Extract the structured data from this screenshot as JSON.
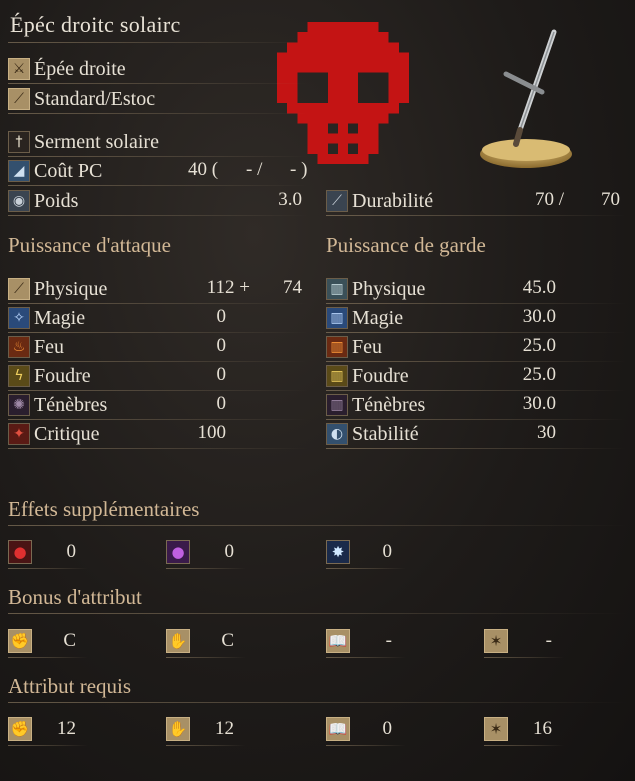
{
  "item_name": "Épéc droitc solairc",
  "weapon": {
    "type": "Épée droite",
    "attack_type": "Standard/Estoc",
    "skill": "Serment solaire",
    "fp_cost_label": "Coût PC",
    "fp_cost_value": "40 (",
    "fp_cost_mid": "- /",
    "fp_cost_end": "- )",
    "weight_label": "Poids",
    "weight_value": "3.0",
    "durability_label": "Durabilité",
    "durability_current": "70 /",
    "durability_max": "70"
  },
  "attack": {
    "header": "Puissance d'attaque",
    "rows": [
      {
        "label": "Physique",
        "value": "112 +",
        "extra": "74",
        "icon": "physical-attack-icon"
      },
      {
        "label": "Magie",
        "value": "0",
        "extra": "",
        "icon": "magic-icon"
      },
      {
        "label": "Feu",
        "value": "0",
        "extra": "",
        "icon": "fire-icon"
      },
      {
        "label": "Foudre",
        "value": "0",
        "extra": "",
        "icon": "lightning-icon"
      },
      {
        "label": "Ténèbres",
        "value": "0",
        "extra": "",
        "icon": "dark-icon"
      },
      {
        "label": "Critique",
        "value": "100",
        "extra": "",
        "icon": "critical-icon"
      }
    ]
  },
  "guard": {
    "header": "Puissance de garde",
    "rows": [
      {
        "label": "Physique",
        "value": "45.0"
      },
      {
        "label": "Magie",
        "value": "30.0"
      },
      {
        "label": "Feu",
        "value": "25.0"
      },
      {
        "label": "Foudre",
        "value": "25.0"
      },
      {
        "label": "Ténèbres",
        "value": "30.0"
      },
      {
        "label": "Stabilité",
        "value": "30"
      }
    ]
  },
  "effects": {
    "header": "Effets supplémentaires",
    "values": [
      "0",
      "0",
      "0"
    ]
  },
  "bonus": {
    "header": "Bonus d'attribut",
    "values": [
      "C",
      "C",
      "-",
      "-"
    ]
  },
  "requirements": {
    "header": "Attribut requis",
    "values": [
      "12",
      "12",
      "0",
      "16"
    ]
  },
  "colors": {
    "skull_red": "#c41414",
    "section_text": "#d2b896"
  }
}
